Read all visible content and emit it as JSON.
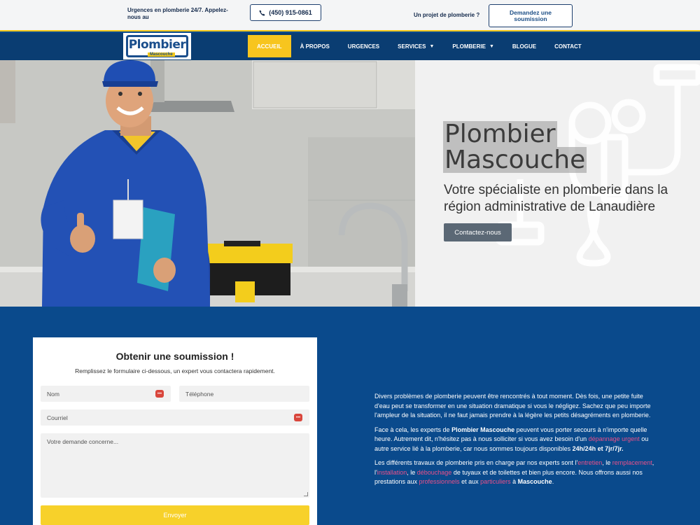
{
  "topbar": {
    "emergency_text": "Urgences en plomberie 24/7. Appelez-nous au",
    "phone_label": "(450) 915-0861",
    "project_text": "Un projet de plomberie ?",
    "quote_button_label": "Demandez une soumission"
  },
  "logo": {
    "word": "Plombier",
    "sub": "Mascouche"
  },
  "nav": {
    "items": [
      {
        "label": "ACCUEIL"
      },
      {
        "label": "À PROPOS"
      },
      {
        "label": "URGENCES"
      },
      {
        "label": "SERVICES"
      },
      {
        "label": "PLOMBERIE"
      },
      {
        "label": "BLOGUE"
      },
      {
        "label": "CONTACT"
      }
    ],
    "active": "ACCUEIL"
  },
  "hero": {
    "title_line1": "Plombier",
    "title_line2": "Mascouche",
    "subtitle": "Votre spécialiste en plomberie dans la région administrative de Lanaudière",
    "cta_label": "Contactez-nous"
  },
  "form": {
    "title": "Obtenir une soumission !",
    "description": "Remplissez le formulaire ci-dessous, un expert vous contactera rapidement.",
    "name_placeholder": "Nom",
    "phone_placeholder": "Téléphone",
    "email_placeholder": "Courriel",
    "message_placeholder": "Votre demande concerne...",
    "submit_label": "Envoyer"
  },
  "content": {
    "p1": "Divers problèmes de plomberie peuvent être rencontrés à tout moment. Dès fois, une petite fuite d'eau peut se transformer en une situation dramatique si vous le négligez. Sachez que peu importe l'ampleur de la situation, il ne faut jamais prendre à la légère les petits désagréments en plomberie.",
    "p2_a": "Face à cela, les experts de ",
    "p2_brand": "Plombier Mascouche",
    "p2_b": " peuvent vous porter secours à n'importe quelle heure. Autrement dit, n'hésitez pas à nous solliciter si vous avez besoin d'un ",
    "p2_link": "dépannage urgent",
    "p2_c": " ou autre service lié à la plomberie, car nous sommes toujours disponibles ",
    "p2_hours": "24h/24h et 7jr/7jr.",
    "p3_a": "Les différents travaux de plomberie pris en charge par nos experts sont l'",
    "p3_link1": "entretien",
    "p3_b": ", le ",
    "p3_link2": "remplacement",
    "p3_c": ", l'",
    "p3_link3": "installation",
    "p3_d": ", le ",
    "p3_link4": "débouchage",
    "p3_e": " de tuyaux et de toilettes et bien plus encore. Nous offrons aussi nos prestations aux ",
    "p3_link5": "professionnels",
    "p3_f": " et aux ",
    "p3_link6": "particuliers",
    "p3_g": " à ",
    "p3_city": "Mascouche",
    "p3_h": "."
  },
  "colors": {
    "navy": "#0a3d72",
    "section_blue": "#0a4a8c",
    "accent_yellow": "#f7c51e",
    "link_pink": "#e8508a",
    "cta_gray": "#5b6875"
  }
}
